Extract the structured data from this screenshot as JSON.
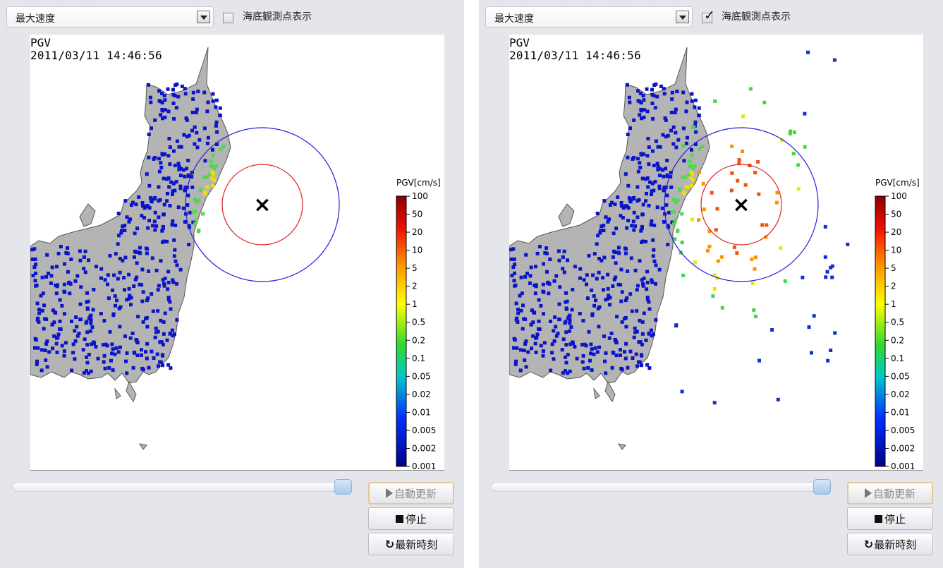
{
  "panels": [
    {
      "select": {
        "value": "最大速度"
      },
      "checkbox": {
        "label": "海底観測点表示",
        "checked": false
      },
      "map": {
        "title": "PGV",
        "timestamp": "2011/03/11 14:46:56",
        "legend_title": "PGV[cm/s]",
        "legend_ticks": [
          "100",
          "50",
          "20",
          "10",
          "5",
          "2",
          "1",
          "0.5",
          "0.2",
          "0.1",
          "0.05",
          "0.02",
          "0.01",
          "0.005",
          "0.002",
          "0.001"
        ],
        "epicenter_symbol": "×"
      },
      "buttons": {
        "auto_update": "自動更新",
        "stop": "停止",
        "latest_time": "最新時刻"
      }
    },
    {
      "select": {
        "value": "最大速度"
      },
      "checkbox": {
        "label": "海底観測点表示",
        "checked": true
      },
      "map": {
        "title": "PGV",
        "timestamp": "2011/03/11 14:46:56",
        "legend_title": "PGV[cm/s]",
        "legend_ticks": [
          "100",
          "50",
          "20",
          "10",
          "5",
          "2",
          "1",
          "0.5",
          "0.2",
          "0.1",
          "0.05",
          "0.02",
          "0.01",
          "0.005",
          "0.002",
          "0.001"
        ],
        "epicenter_symbol": "×"
      },
      "buttons": {
        "auto_update": "自動更新",
        "stop": "停止",
        "latest_time": "最新時刻"
      }
    }
  ],
  "colors": {
    "panel_bg": "#e5e6ec",
    "land": "#b4b4b4",
    "station_low": "#0a14c8",
    "s_wave_circle": "#2020e0",
    "p_wave_circle": "#e02020",
    "button_focus_border": "#e3c79a"
  },
  "icons": {
    "dropdown": "chevron-down-icon",
    "play": "play-icon",
    "stop": "stop-icon",
    "refresh": "refresh-icon",
    "checkmark": "checkmark-icon"
  }
}
